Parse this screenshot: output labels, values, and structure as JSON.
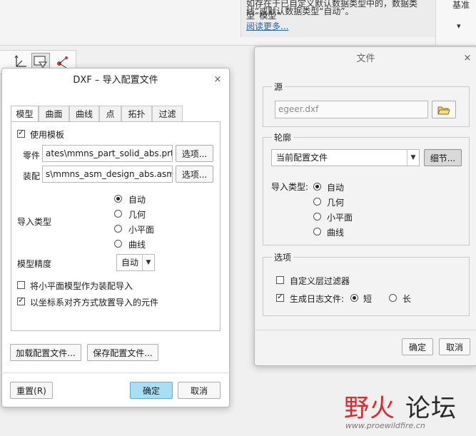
{
  "top": {
    "tooltip_line1": "如存在于已自定义默认数据类型中的，数据类型“模型”",
    "tooltip_line2": "线”或默认数据类型“自动”。",
    "read_more": "阅读更多...",
    "right_label": "基准",
    "chevron": "▾"
  },
  "dxf_dialog": {
    "title": "DXF – 导入配置文件",
    "close": "×",
    "tabs": [
      "模型",
      "曲面",
      "曲线",
      "点",
      "拓扑",
      "过滤"
    ],
    "active_tab": "模型",
    "use_template": {
      "label": "使用模板",
      "checked": true
    },
    "part_label": "零件",
    "part_value": "ates\\mmns_part_solid_abs.prt",
    "part_button": "选项...",
    "asm_label": "装配",
    "asm_value": "s\\mmns_asm_design_abs.asm",
    "asm_button": "选项...",
    "import_type_label": "导入类型",
    "import_types": [
      "自动",
      "几何",
      "小平面",
      "曲线"
    ],
    "import_type_selected": "自动",
    "precision_label": "模型精度",
    "precision_value": "自动",
    "facet_as_asm": {
      "label": "将小平面模型作为装配导入",
      "checked": false
    },
    "align_csys": {
      "label": "以坐标系对齐方式放置导入的元件",
      "checked": true
    },
    "load_config": "加载配置文件...",
    "save_config": "保存配置文件...",
    "reset": "重置(R)",
    "ok": "确定",
    "cancel": "取消"
  },
  "file_dialog": {
    "title": "文件",
    "close": "×",
    "source_group": "源",
    "source_value": "egeer.dxf",
    "profile_group": "轮廓",
    "profile_value": "当前配置文件",
    "details_button": "细节...",
    "import_type_label": "导入类型:",
    "import_types": [
      "自动",
      "几何",
      "小平面",
      "曲线"
    ],
    "import_type_selected": "自动",
    "options_group": "选项",
    "custom_layer_filter": {
      "label": "自定义层过滤器",
      "checked": false
    },
    "log_file": {
      "label": "生成日志文件:",
      "checked": true
    },
    "log_short": "短",
    "log_long": "长",
    "log_selected": "短",
    "ok": "确定",
    "cancel": "取消"
  },
  "watermark": {
    "title_a": "野火",
    "title_b": "论坛",
    "url": "www.proewildfire.cn",
    "color_a": "#d92b2b",
    "color_b": "#2a2a2a"
  }
}
